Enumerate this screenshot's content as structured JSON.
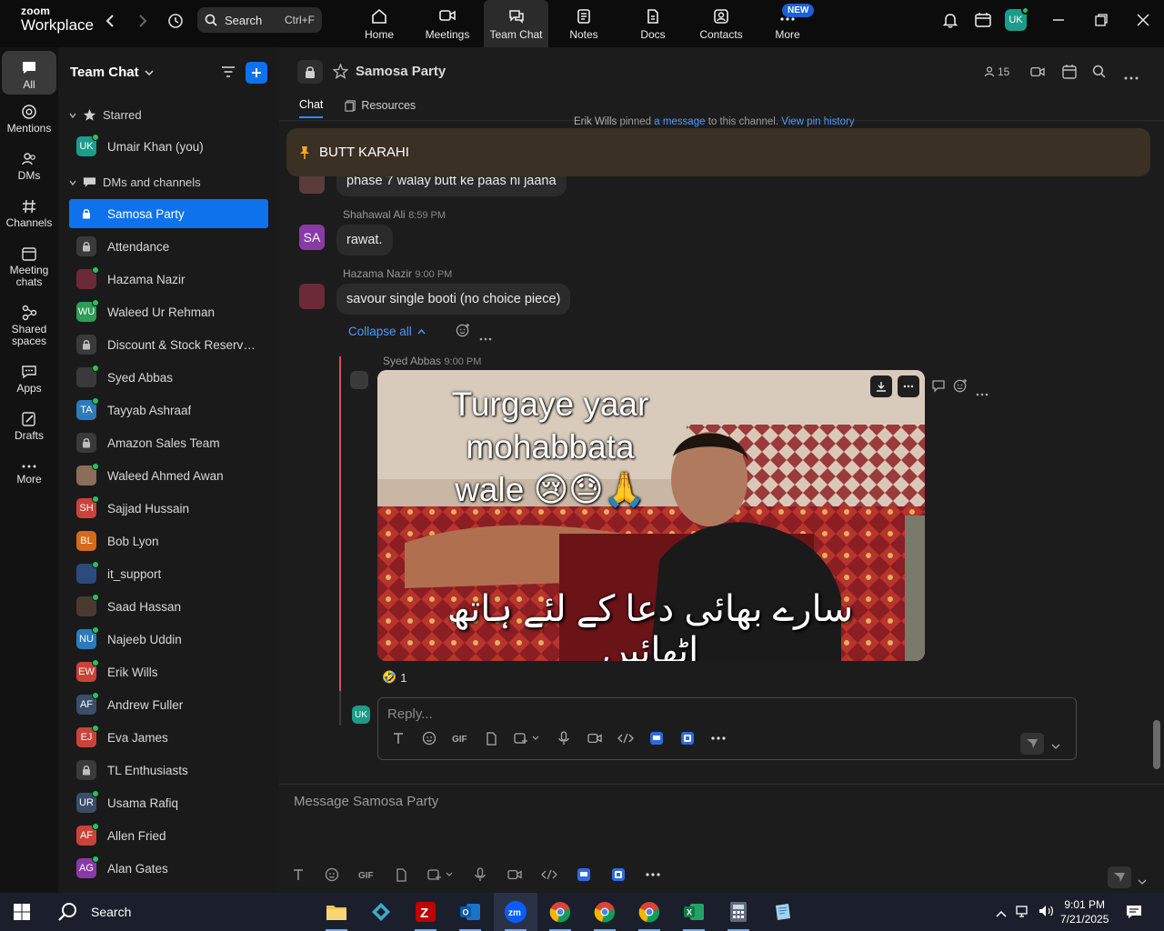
{
  "app": {
    "brand_top": "zoom",
    "brand_bottom": "Workplace"
  },
  "topbar": {
    "search_label": "Search",
    "search_shortcut": "Ctrl+F",
    "tabs": [
      {
        "label": "Home",
        "icon": "home-icon"
      },
      {
        "label": "Meetings",
        "icon": "video-icon"
      },
      {
        "label": "Team Chat",
        "icon": "chat-icon"
      },
      {
        "label": "Notes",
        "icon": "notes-icon"
      },
      {
        "label": "Docs",
        "icon": "docs-icon"
      },
      {
        "label": "Contacts",
        "icon": "contacts-icon"
      },
      {
        "label": "More",
        "icon": "more-icon"
      }
    ],
    "new_badge": "NEW",
    "user_initials": "UK"
  },
  "rail": [
    {
      "label": "All"
    },
    {
      "label": "Mentions"
    },
    {
      "label": "DMs"
    },
    {
      "label": "Channels"
    },
    {
      "label": "Meeting chats"
    },
    {
      "label": "Shared spaces"
    },
    {
      "label": "Apps"
    },
    {
      "label": "Drafts"
    },
    {
      "label": "More"
    }
  ],
  "sidebar": {
    "title": "Team Chat",
    "starred_label": "Starred",
    "dms_label": "DMs and channels",
    "starred": [
      {
        "name": "Umair Khan (you)",
        "initials": "UK",
        "color": "#1c9c8a",
        "online": true
      }
    ],
    "items": [
      {
        "name": "Samosa Party",
        "type": "lock",
        "active": true
      },
      {
        "name": "Attendance",
        "type": "lock"
      },
      {
        "name": "Hazama Nazir",
        "type": "photo",
        "color": "#6b2a36",
        "online": true
      },
      {
        "name": "Waleed Ur Rehman",
        "initials": "WU",
        "color": "#2c9e55",
        "online": true
      },
      {
        "name": "Discount & Stock Reservati...",
        "type": "lock"
      },
      {
        "name": "Syed Abbas",
        "type": "photo",
        "color": "#3a3a3a",
        "online": true
      },
      {
        "name": "Tayyab Ashraaf",
        "initials": "TA",
        "color": "#2b7bbd",
        "online": true
      },
      {
        "name": "Amazon Sales Team",
        "type": "lock"
      },
      {
        "name": "Waleed Ahmed Awan",
        "type": "photo",
        "color": "#8a6e5a",
        "online": true
      },
      {
        "name": "Sajjad Hussain",
        "initials": "SH",
        "color": "#c9433a",
        "online": true
      },
      {
        "name": "Bob Lyon",
        "initials": "BL",
        "color": "#d46a1a",
        "online": false
      },
      {
        "name": "it_support",
        "type": "photo",
        "color": "#2a4b7c",
        "online": true
      },
      {
        "name": "Saad Hassan",
        "type": "photo",
        "color": "#4a3a30",
        "online": true
      },
      {
        "name": "Najeeb Uddin",
        "initials": "NU",
        "color": "#2b7bbd",
        "online": true
      },
      {
        "name": "Erik Wills",
        "initials": "EW",
        "color": "#c9433a",
        "online": true
      },
      {
        "name": "Andrew Fuller",
        "initials": "AF",
        "color": "#3a4e6a",
        "online": true
      },
      {
        "name": "Eva James",
        "initials": "EJ",
        "color": "#c9433a",
        "online": true
      },
      {
        "name": "TL Enthusiasts",
        "type": "lock"
      },
      {
        "name": "Usama Rafiq",
        "initials": "UR",
        "color": "#3a4e6a",
        "online": true
      },
      {
        "name": "Allen Fried",
        "initials": "AF",
        "color": "#c9433a",
        "online": true
      },
      {
        "name": "Alan Gates",
        "initials": "AG",
        "color": "#8a3aa8",
        "online": true
      }
    ]
  },
  "channel": {
    "title": "Samosa Party",
    "members": "15",
    "tabs": [
      "Chat",
      "Resources"
    ],
    "pin_notice_user": "Erik Wills",
    "pin_notice_mid": "pinned",
    "pin_notice_link1": "a message",
    "pin_notice_tail": "to this channel.",
    "pin_notice_link2": "View pin history",
    "pinned_text": "BUTT KARAHI"
  },
  "messages": {
    "m0": {
      "text": "phase 7 walay butt ke paas ni jaana"
    },
    "m1": {
      "author": "Shahawal Ali",
      "time": "8:59 PM",
      "text": "rawat.",
      "initials": "SA"
    },
    "m2": {
      "author": "Hazama Nazir",
      "time": "9:00 PM",
      "text": "savour single booti (no choice piece)"
    },
    "collapse_label": "Collapse all",
    "reply": {
      "author": "Syed Abbas",
      "time": "9:00 PM",
      "meme_top": "Turgaye yaar mohabbata wale 😢😓🙏",
      "meme_urdu": "سارے بھائی دعا کے لئے ہاتھ اٹھائیں",
      "reaction_emoji": "🤣",
      "reaction_count": "1"
    }
  },
  "reply_box": {
    "placeholder": "Reply...",
    "user_initials": "UK"
  },
  "compose": {
    "placeholder": "Message Samosa Party"
  },
  "taskbar": {
    "search_label": "Search",
    "time": "9:01 PM",
    "date": "7/21/2025"
  }
}
